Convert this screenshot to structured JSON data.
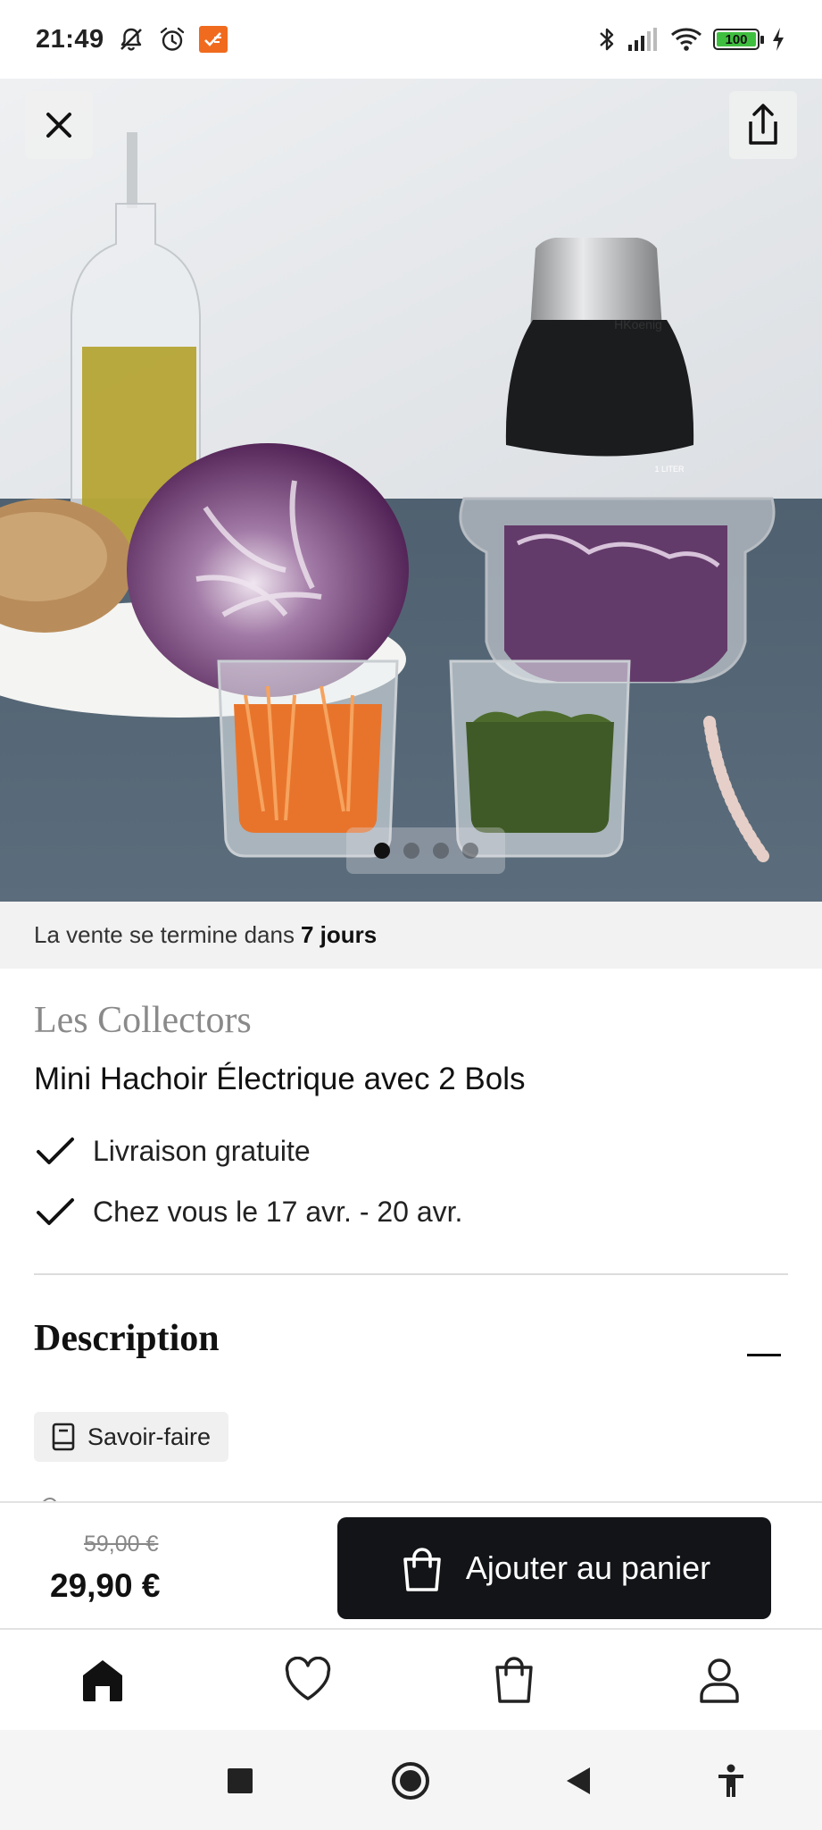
{
  "status_bar": {
    "time": "21:49",
    "left_icons": [
      "mute-icon",
      "alarm-icon",
      "app-notification-icon"
    ],
    "right_icons": [
      "bluetooth-icon",
      "signal-icon",
      "wifi-icon",
      "battery-icon",
      "charging-icon"
    ],
    "battery_level": "100"
  },
  "hero": {
    "product_brand_on_device": "HKoenig",
    "bowl_capacity_label": "1 LITER",
    "slides_total": 4,
    "active_slide": 1,
    "close_icon": "close-icon",
    "share_icon": "share-icon"
  },
  "sale": {
    "prefix": "La vente se termine dans",
    "remaining": "7 jours"
  },
  "product": {
    "brand": "Les Collectors",
    "title": "Mini Hachoir Électrique avec 2 Bols",
    "features": [
      {
        "icon": "check-icon",
        "text": "Livraison gratuite"
      },
      {
        "icon": "check-icon",
        "text": "Chez vous le 17 avr. - 20 avr."
      }
    ]
  },
  "description": {
    "heading": "Description",
    "toggle_icon": "minus-icon",
    "chip_label": "Savoir-faire",
    "chip_icon": "book-icon"
  },
  "purchase": {
    "old_price": "59,00 €",
    "price": "29,90 €",
    "add_to_cart_label": "Ajouter au panier",
    "button_icon": "shopping-bag-icon"
  },
  "bottom_nav": [
    {
      "icon": "home-icon",
      "active": true
    },
    {
      "icon": "heart-icon",
      "active": false
    },
    {
      "icon": "bag-icon",
      "active": false
    },
    {
      "icon": "profile-icon",
      "active": false
    }
  ],
  "system_nav": [
    "recents-button",
    "home-button",
    "back-button",
    "accessibility-button"
  ],
  "colors": {
    "primary_dark": "#121417",
    "sale_banner_bg": "#f2f2f2",
    "brand_gray": "#8a8a8a"
  }
}
